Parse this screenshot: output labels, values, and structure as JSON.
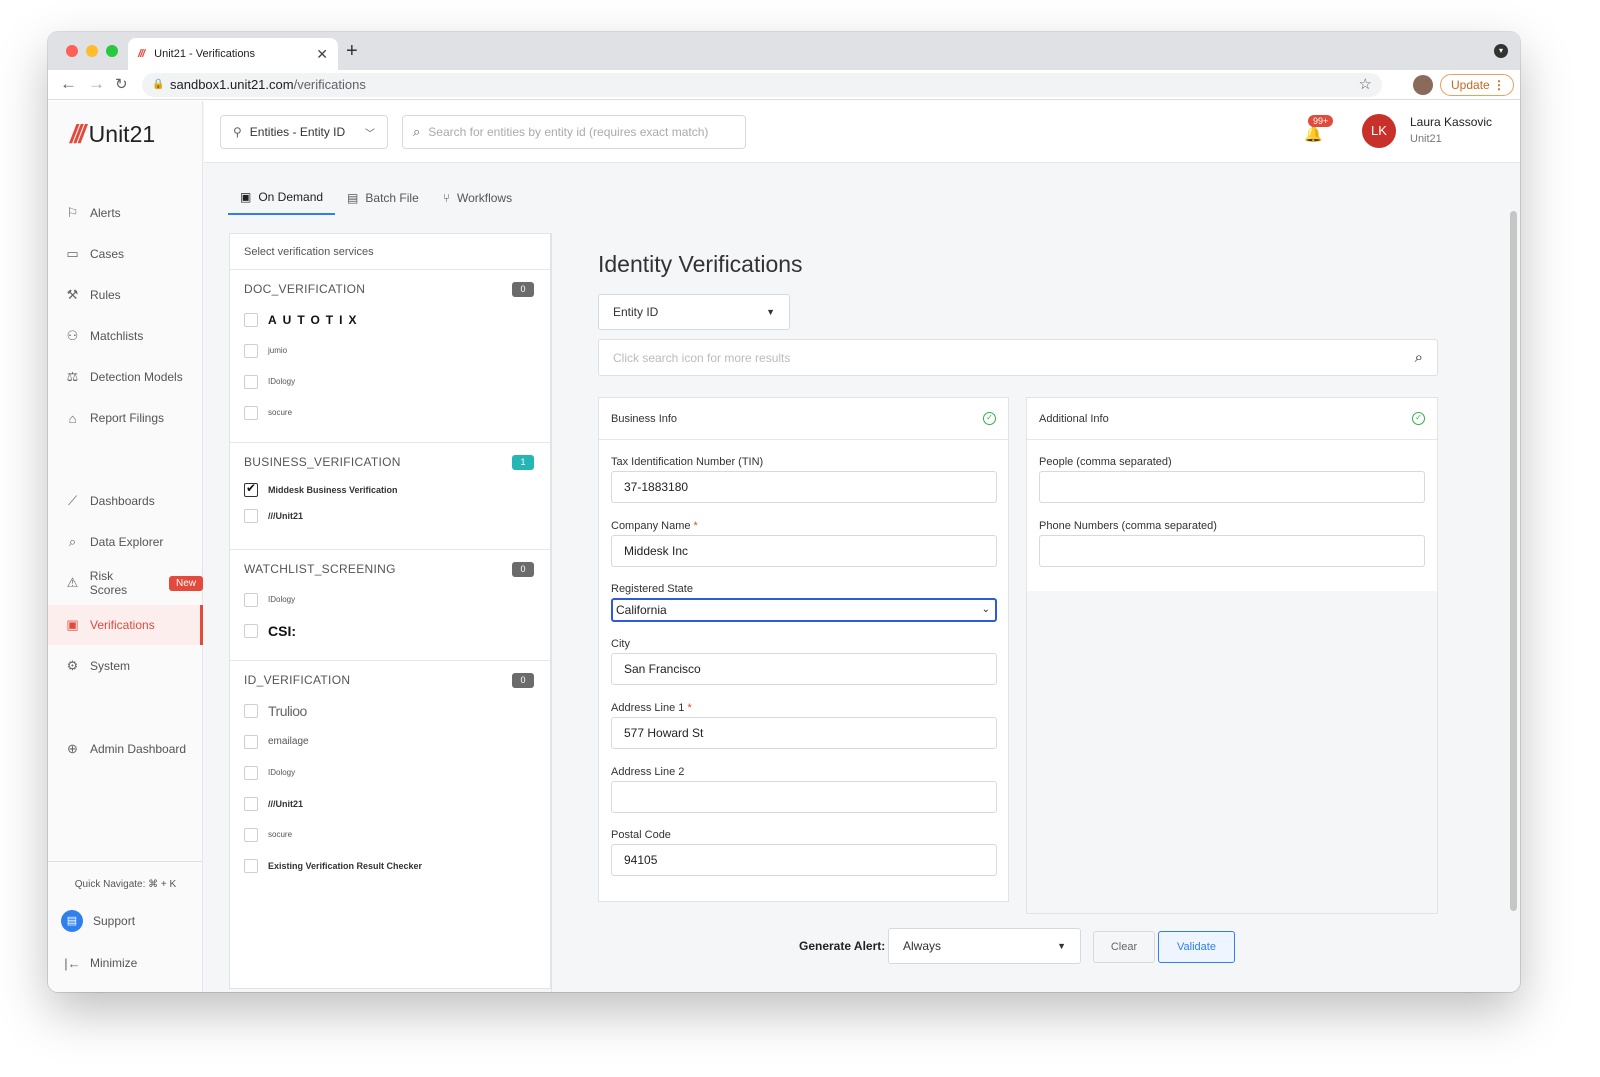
{
  "browser": {
    "tab_title": "Unit21 - Verifications",
    "tab_favicon": "///",
    "url_host": "sandbox1.unit21.com",
    "url_path": "/verifications",
    "update_label": "Update"
  },
  "app": {
    "logo_slashes": "///",
    "logo_text": "Unit21"
  },
  "sidebar": {
    "items": [
      {
        "label": "Alerts",
        "icon": "flag-icon"
      },
      {
        "label": "Cases",
        "icon": "briefcase-icon"
      },
      {
        "label": "Rules",
        "icon": "rules-icon"
      },
      {
        "label": "Matchlists",
        "icon": "person-x-icon"
      },
      {
        "label": "Detection Models",
        "icon": "scale-icon"
      },
      {
        "label": "Report Filings",
        "icon": "bank-icon"
      },
      {
        "label": "Dashboards",
        "icon": "chart-icon"
      },
      {
        "label": "Data Explorer",
        "icon": "data-explorer-icon"
      },
      {
        "label": "Risk Scores",
        "icon": "warning-icon",
        "badge": "New"
      },
      {
        "label": "Verifications",
        "icon": "id-card-icon",
        "active": true
      },
      {
        "label": "System",
        "icon": "gear-icon"
      },
      {
        "label": "Admin Dashboard",
        "icon": "globe-icon"
      }
    ],
    "quick_navigate": "Quick Navigate: ⌘ + K",
    "support_label": "Support",
    "minimize_label": "Minimize"
  },
  "topbar": {
    "entity_dropdown": "Entities - Entity ID",
    "search_placeholder": "Search for entities by entity id (requires exact match)",
    "notification_count": "99+",
    "user_initials": "LK",
    "user_name": "Laura Kassovic",
    "user_org": "Unit21"
  },
  "tabs": [
    {
      "label": "On Demand",
      "active": true
    },
    {
      "label": "Batch File"
    },
    {
      "label": "Workflows"
    }
  ],
  "services": {
    "header": "Select verification services",
    "groups": [
      {
        "title": "DOC_VERIFICATION",
        "count": "0",
        "items": [
          "AUTOTIX",
          "jumio",
          "IDology",
          "socure"
        ]
      },
      {
        "title": "BUSINESS_VERIFICATION",
        "count": "1",
        "items": [
          "Middesk Business Verification",
          "///Unit21"
        ]
      },
      {
        "title": "WATCHLIST_SCREENING",
        "count": "0",
        "items": [
          "IDology",
          "CSI:"
        ]
      },
      {
        "title": "ID_VERIFICATION",
        "count": "0",
        "items": [
          "Trulioo",
          "emailage",
          "IDology",
          "///Unit21",
          "socure",
          "Existing Verification Result Checker"
        ]
      }
    ]
  },
  "identity": {
    "title": "Identity Verifications",
    "type_dropdown": "Entity ID",
    "search_placeholder": "Click search icon for more results"
  },
  "business_info": {
    "title": "Business Info",
    "tin_label": "Tax Identification Number (TIN)",
    "tin_value": "37-1883180",
    "company_label": "Company Name",
    "company_value": "Middesk Inc",
    "state_label": "Registered State",
    "state_value": "California",
    "city_label": "City",
    "city_value": "San Francisco",
    "addr1_label": "Address Line 1",
    "addr1_value": "577 Howard St",
    "addr2_label": "Address Line 2",
    "addr2_value": "",
    "postal_label": "Postal Code",
    "postal_value": "94105",
    "required_mark": "*"
  },
  "additional_info": {
    "title": "Additional Info",
    "people_label": "People (comma separated)",
    "people_value": "",
    "phones_label": "Phone Numbers (comma separated)",
    "phones_value": ""
  },
  "footer": {
    "generate_alert_label": "Generate Alert:",
    "generate_alert_value": "Always",
    "clear_label": "Clear",
    "validate_label": "Validate"
  }
}
